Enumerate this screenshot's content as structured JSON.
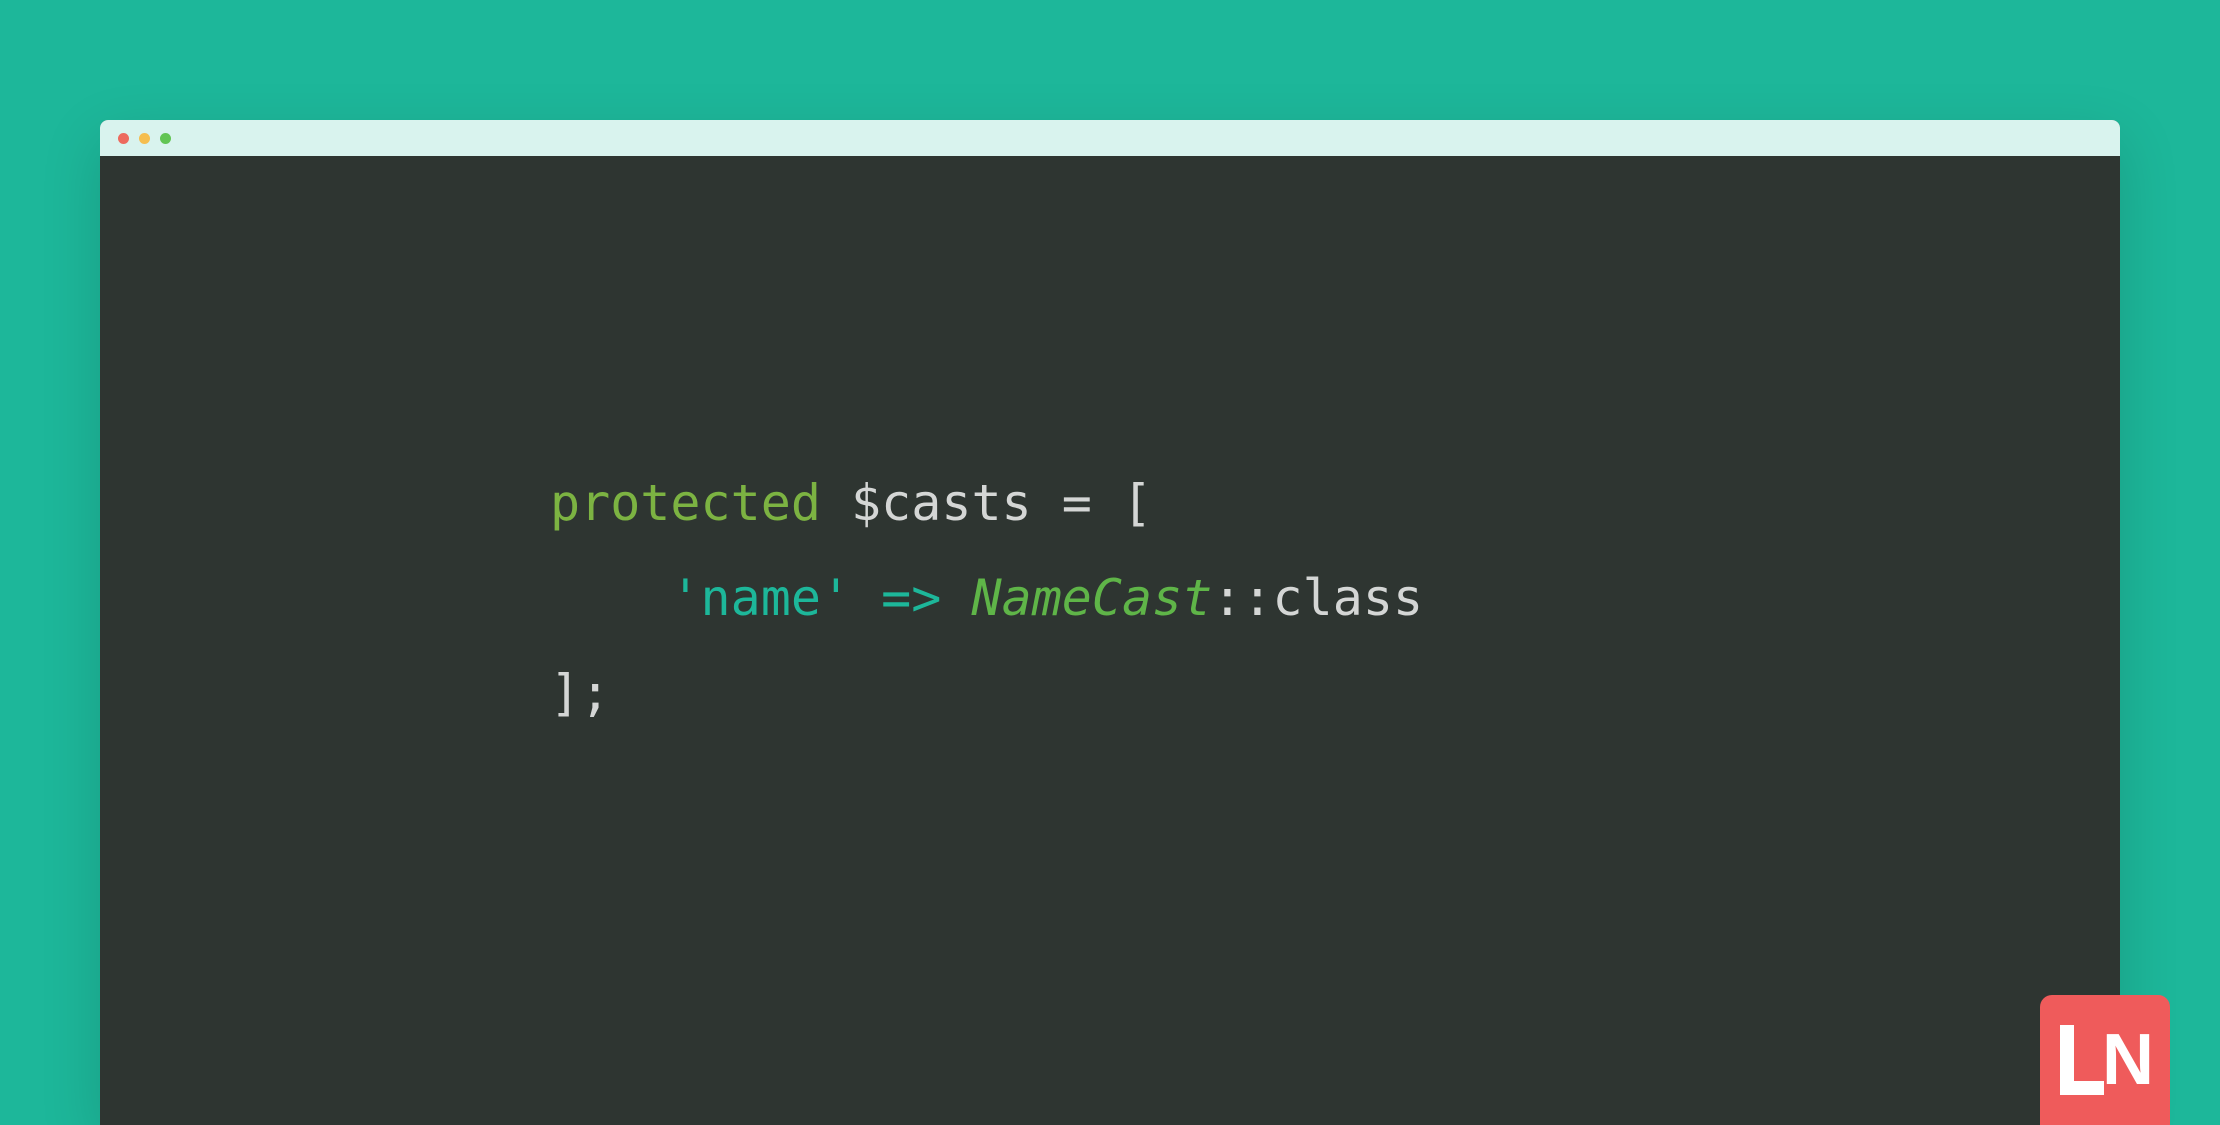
{
  "code": {
    "line1": {
      "keyword": "protected",
      "variable": "$casts",
      "equals": "=",
      "bracket_open": "["
    },
    "line2": {
      "indent": "    ",
      "string": "'name'",
      "arrow": "=>",
      "classname": "NameCast",
      "scope": "::",
      "member": "class"
    },
    "line3": {
      "bracket_close": "];"
    }
  },
  "logo": {
    "text": "N"
  },
  "colors": {
    "background": "#1db79a",
    "editor_bg": "#2e3531",
    "titlebar_bg": "#d9f3ee",
    "logo_bg": "#ef5b5b",
    "keyword": "#7cb342",
    "text": "#d4d6d5",
    "string": "#1db79a",
    "classname": "#5fb548"
  }
}
